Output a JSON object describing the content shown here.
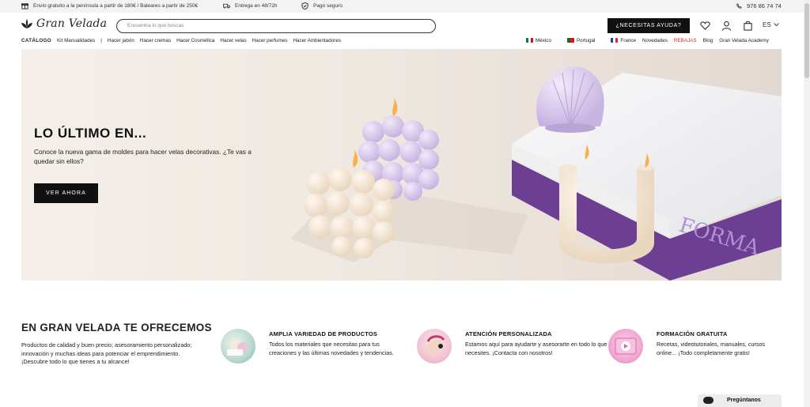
{
  "topbar": {
    "shipping_text": "Envío gratuito a la península a partir de 180€ / Baleares a partir de 250€",
    "delivery_text": "Entrega en 48/72h",
    "payment_text": "Pago seguro",
    "phone": "976 86 74 74"
  },
  "header": {
    "logo_text": "Gran Velada",
    "search_placeholder": "Encuentra lo que buscas",
    "help_button": "¿NECESITAS AYUDA?",
    "language": "ES"
  },
  "nav": {
    "left": [
      "CATÁLOGO",
      "Kit Manualidades",
      "|",
      "Hacer jabón",
      "Hacer cremas",
      "Hacer Cosmética",
      "Hacer velas",
      "Hacer perfumes",
      "Hacer Ambientadores"
    ],
    "mexico": "México",
    "portugal": "Portugal",
    "france": "France",
    "novedades": "Novedades",
    "rebajas": "REBAJAS",
    "blog": "Blog",
    "academy": "Gran Velada Academy"
  },
  "hero": {
    "title": "LO ÚLTIMO EN...",
    "subtitle": "Conoce la nueva gama de moldes para hacer velas decorativas. ¿Te vas a quedar sin ellos?",
    "cta": "VER AHORA",
    "book_text": "FORMA"
  },
  "offer": {
    "title": "EN GRAN VELADA TE OFRECEMOS",
    "text": "Productos de calidad y buen precio; asesoramiento personalizado; innovación y muchas ideas para potenciar el emprendimiento. ¡Descubre todo lo que tienes a tu alcance!"
  },
  "features": [
    {
      "title": "AMPLIA VARIEDAD DE PRODUCTOS",
      "text": "Todos los materiales que necesitas para tus creaciones y las últimas novedades y tendencias."
    },
    {
      "title": "ATENCIÓN PERSONALIZADA",
      "text": "Estamos aquí para ayudarte y asesorarte en todo lo que necesites. ¡Contacta con nosotros!"
    },
    {
      "title": "FORMACIÓN GRATUITA",
      "text": "Recetas, videotutoriales, manuales, cursos online... ¡Todo completamente gratis!"
    }
  ],
  "chat": {
    "label": "Pregúntanos"
  },
  "colors": {
    "accent": "#111111",
    "sale": "#d12f2f",
    "lilac": "#c9b8e6",
    "purple_book": "#6b3d8f"
  }
}
